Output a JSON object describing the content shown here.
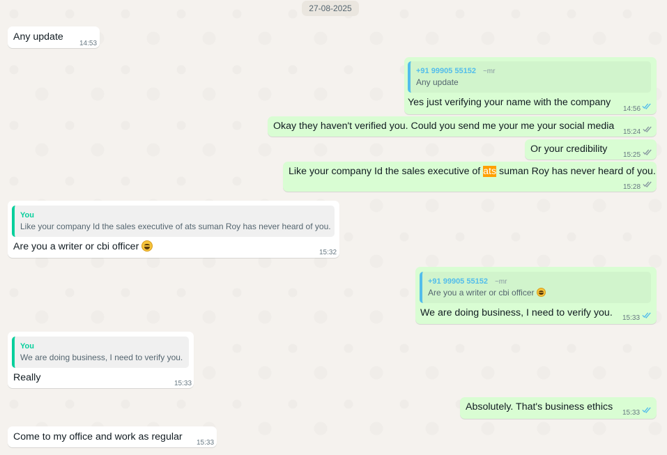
{
  "date_chip": "27-08-2025",
  "colors": {
    "incoming_bubble": "#ffffff",
    "outgoing_bubble": "#d9fdd3",
    "quote_self": "#06cf9c",
    "quote_other": "#53bdeb",
    "read_tick": "#53bdeb",
    "delivered_tick": "#8696a0",
    "highlight": "#ff9f00"
  },
  "messages": [
    {
      "id": "m1",
      "dir": "in",
      "text": "Any update",
      "time": "14:53"
    },
    {
      "id": "m2",
      "dir": "out",
      "quote": {
        "author": "+91 99905 55152",
        "author_sub": "~mr",
        "text": "Any update"
      },
      "text": "Yes just verifying your name with the company",
      "time": "14:56",
      "tick": "double-check-read-icon"
    },
    {
      "id": "m3",
      "dir": "out",
      "text": "Okay they haven't verified you. Could you send me your me your social media",
      "time": "15:24",
      "tick": "double-check-icon"
    },
    {
      "id": "m4",
      "dir": "out",
      "text": "Or your credibility",
      "time": "15:25",
      "tick": "double-check-icon"
    },
    {
      "id": "m5",
      "dir": "out",
      "text_before": "Like your company Id the sales executive of ",
      "text_highlight": "ats",
      "text_after": " suman Roy has never heard of you.",
      "time": "15:28",
      "tick": "double-check-icon"
    },
    {
      "id": "m6",
      "dir": "in",
      "quote": {
        "author": "You",
        "text": "Like your company Id the sales executive of ats suman Roy has never heard of you."
      },
      "text": "Are you a writer or cbi officer",
      "emoji": "grinning-face-icon",
      "time": "15:32"
    },
    {
      "id": "m7",
      "dir": "out",
      "quote": {
        "author": "+91 99905 55152",
        "author_sub": "~mr",
        "text": "Are you a writer or cbi officer",
        "emoji": "grinning-face-icon"
      },
      "text": "We are doing business, I need to verify you.",
      "time": "15:33",
      "tick": "double-check-read-icon"
    },
    {
      "id": "m8",
      "dir": "in",
      "quote": {
        "author": "You",
        "text": "We are doing business, I need to verify you."
      },
      "text": "Really",
      "time": "15:33"
    },
    {
      "id": "m9",
      "dir": "out",
      "text": "Absolutely. That's business ethics",
      "time": "15:33",
      "tick": "double-check-read-icon"
    },
    {
      "id": "m10",
      "dir": "in",
      "text": "Come to my office and work as regular",
      "time": "15:33"
    }
  ]
}
